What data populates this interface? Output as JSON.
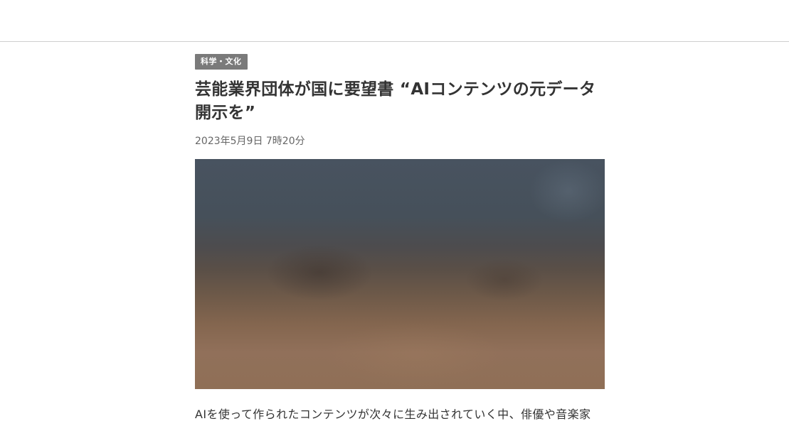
{
  "article": {
    "category": "科学・文化",
    "headline": "芸能業界団体が国に要望書 “AIコンテンツの元データ開示を”",
    "timestamp": "2023年5月9日 7時20分",
    "body_first_line": "AIを使って作られたコンテンツが次々に生み出されていく中、俳優や音楽家"
  },
  "colors": {
    "badge_background": "#7a7a7a",
    "badge_text": "#ffffff",
    "headline": "#333333",
    "timestamp": "#666666",
    "divider": "#cfcfcf"
  }
}
